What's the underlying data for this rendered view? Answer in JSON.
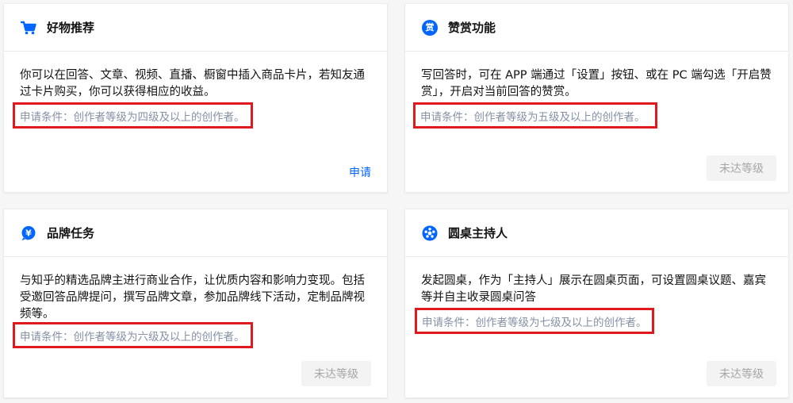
{
  "colors": {
    "accent": "#0066ff",
    "highlight_border": "#e0191f",
    "muted_text": "#8590a6"
  },
  "cards": [
    {
      "icon": "shopping-cart-icon",
      "title": "好物推荐",
      "description": "你可以在回答、文章、视频、直播、橱窗中插入商品卡片，若知友通过卡片购买，你可以获得相应的收益。",
      "condition": "申请条件：创作者等级为四级及以上的创作者。",
      "action": "申请"
    },
    {
      "icon": "reward-icon",
      "icon_glyph": "赏",
      "title": "赞赏功能",
      "description": "写回答时，可在 APP 端通过「设置」按钮、或在 PC 端勾选「开启赞赏」，开启对当前回答的赞赏。",
      "condition": "申请条件：创作者等级为五级及以上的创作者。",
      "action": "未达等级"
    },
    {
      "icon": "brand-task-icon",
      "icon_glyph": "¥",
      "title": "品牌任务",
      "description": "与知乎的精选品牌主进行商业合作，让优质内容和影响力变现。包括受邀回答品牌提问，撰写品牌文章，参加品牌线下活动，定制品牌视频等。",
      "condition": "申请条件：创作者等级为六级及以上的创作者。",
      "action": "未达等级"
    },
    {
      "icon": "roundtable-icon",
      "title": "圆桌主持人",
      "description": "发起圆桌，作为「主持人」展示在圆桌页面，可设置圆桌议题、嘉宾等并自主收录圆桌问答",
      "condition": "申请条件：创作者等级为七级及以上的创作者。",
      "action": "未达等级"
    }
  ]
}
